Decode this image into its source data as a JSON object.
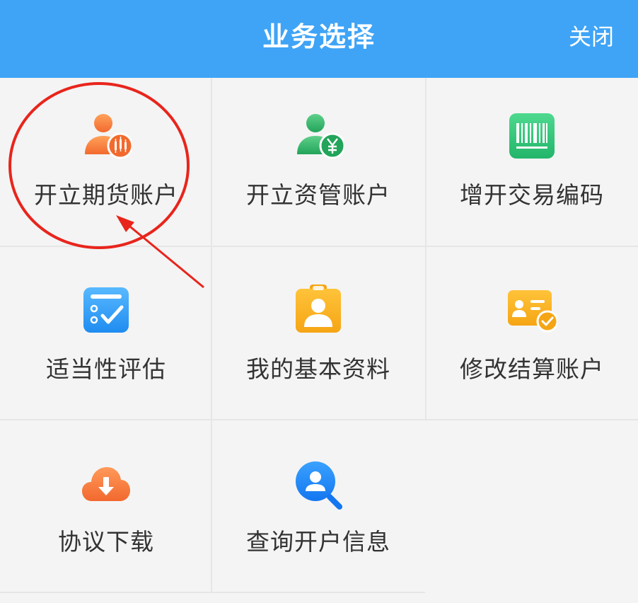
{
  "header": {
    "title": "业务选择",
    "close_label": "关闭"
  },
  "colors": {
    "header_bg": "#3fa4f6",
    "accent_red": "#e8251c"
  },
  "items": [
    {
      "label": "开立期货账户",
      "icon": "user-candlestick-icon"
    },
    {
      "label": "开立资管账户",
      "icon": "user-yen-icon"
    },
    {
      "label": "增开交易编码",
      "icon": "barcode-icon"
    },
    {
      "label": "适当性评估",
      "icon": "checklist-icon"
    },
    {
      "label": "我的基本资料",
      "icon": "id-badge-icon"
    },
    {
      "label": "修改结算账户",
      "icon": "id-card-check-icon"
    },
    {
      "label": "协议下载",
      "icon": "cloud-download-icon"
    },
    {
      "label": "查询开户信息",
      "icon": "search-user-icon"
    }
  ]
}
